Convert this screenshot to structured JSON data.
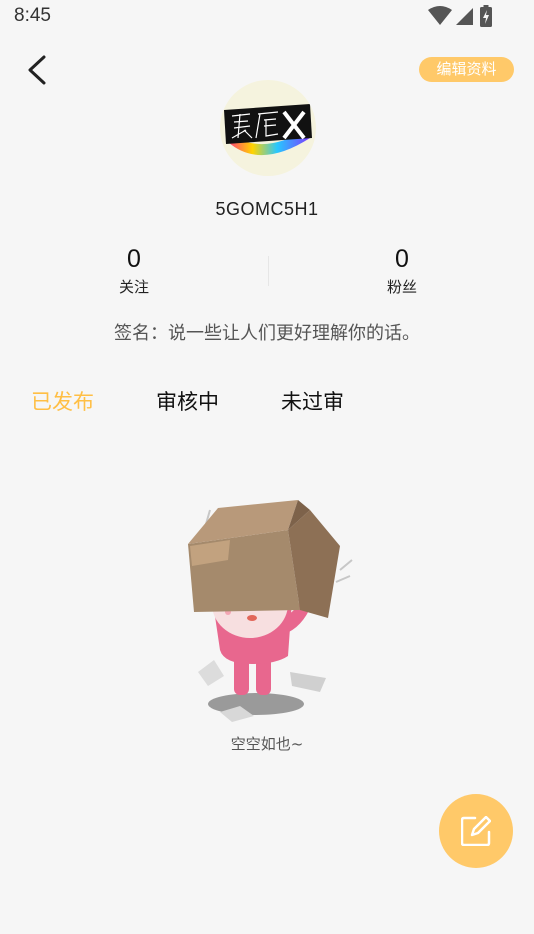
{
  "status_bar": {
    "time": "8:45"
  },
  "header": {
    "edit_profile_label": "编辑资料"
  },
  "profile": {
    "username": "5GOMC5H1",
    "avatar_icon": "aifeng-logo-avatar",
    "following": {
      "count": "0",
      "label": "关注"
    },
    "followers": {
      "count": "0",
      "label": "粉丝"
    },
    "signature": "签名：说一些让人们更好理解你的话。"
  },
  "tabs": [
    {
      "label": "已发布",
      "active": true
    },
    {
      "label": "审核中",
      "active": false
    },
    {
      "label": "未过审",
      "active": false
    }
  ],
  "empty_state": {
    "text": "空空如也~"
  },
  "colors": {
    "accent": "#ffc969",
    "active_tab": "#ffbf45",
    "background": "#f6f6f6"
  }
}
